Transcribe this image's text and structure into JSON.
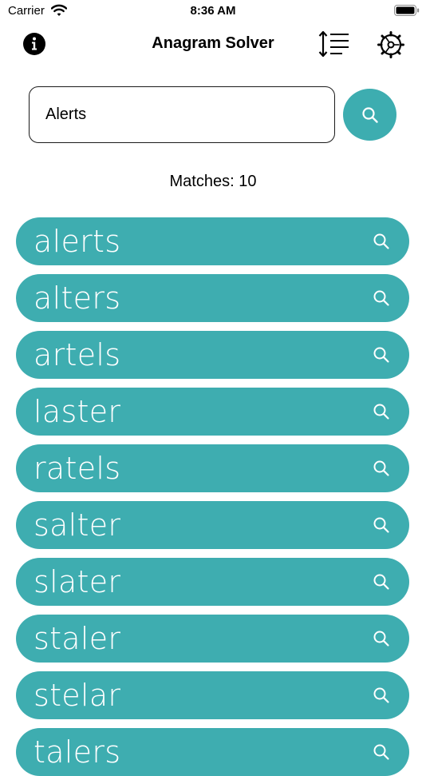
{
  "status_bar": {
    "carrier": "Carrier",
    "time": "8:36 AM"
  },
  "nav": {
    "title": "Anagram Solver"
  },
  "search": {
    "value": "Alerts"
  },
  "matches_text": "Matches: 10",
  "results": [
    "alerts",
    "alters",
    "artels",
    "laster",
    "ratels",
    "salter",
    "slater",
    "staler",
    "stelar",
    "talers"
  ],
  "colors": {
    "accent": "#3eadb0",
    "text_on_accent": "#ffffff",
    "caret": "#2f7de1"
  },
  "icons": [
    "wifi-icon",
    "battery-icon",
    "info-icon",
    "sort-lines-icon",
    "settings-gear-icon",
    "search-icon"
  ]
}
